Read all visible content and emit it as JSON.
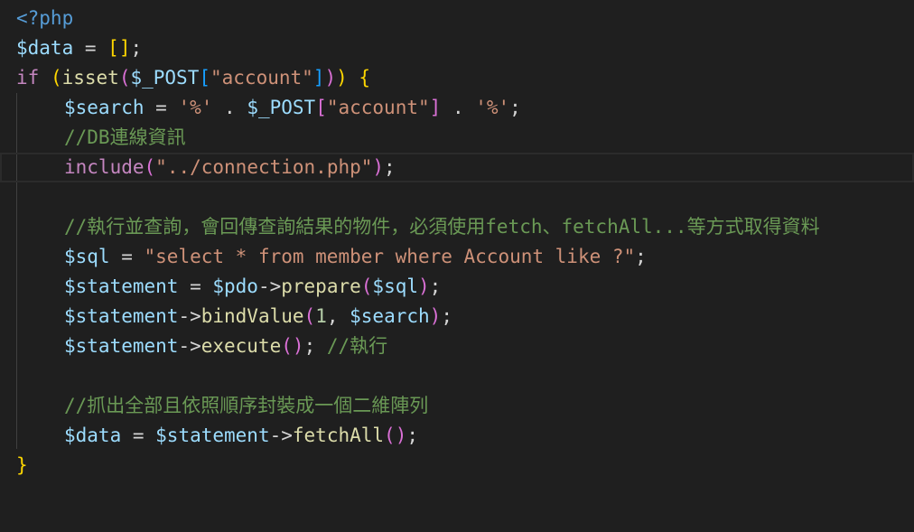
{
  "editor": {
    "language": "php",
    "lines": [
      [
        {
          "t": "<?php",
          "c": "kw-tag"
        }
      ],
      [
        {
          "t": "$data",
          "c": "var"
        },
        {
          "t": " = ",
          "c": "op"
        },
        {
          "t": "[",
          "c": "b1"
        },
        {
          "t": "]",
          "c": "b1"
        },
        {
          "t": ";",
          "c": "op"
        }
      ],
      [
        {
          "t": "if",
          "c": "kw"
        },
        {
          "t": " ",
          "c": "op"
        },
        {
          "t": "(",
          "c": "b1"
        },
        {
          "t": "isset",
          "c": "fn"
        },
        {
          "t": "(",
          "c": "b2"
        },
        {
          "t": "$_POST",
          "c": "var"
        },
        {
          "t": "[",
          "c": "b3"
        },
        {
          "t": "\"account\"",
          "c": "str"
        },
        {
          "t": "]",
          "c": "b3"
        },
        {
          "t": ")",
          "c": "b2"
        },
        {
          "t": ")",
          "c": "b1"
        },
        {
          "t": " ",
          "c": "op"
        },
        {
          "t": "{",
          "c": "b1"
        }
      ],
      [
        {
          "ind": 1
        },
        {
          "t": "$search",
          "c": "var"
        },
        {
          "t": " = ",
          "c": "op"
        },
        {
          "t": "'%'",
          "c": "str"
        },
        {
          "t": " . ",
          "c": "op"
        },
        {
          "t": "$_POST",
          "c": "var"
        },
        {
          "t": "[",
          "c": "b2"
        },
        {
          "t": "\"account\"",
          "c": "str"
        },
        {
          "t": "]",
          "c": "b2"
        },
        {
          "t": " . ",
          "c": "op"
        },
        {
          "t": "'%'",
          "c": "str"
        },
        {
          "t": ";",
          "c": "op"
        }
      ],
      [
        {
          "ind": 1
        },
        {
          "t": "//DB連線資訊",
          "c": "cmt"
        }
      ],
      [
        {
          "ind": 1
        },
        {
          "t": "include",
          "c": "kw"
        },
        {
          "t": "(",
          "c": "b2"
        },
        {
          "t": "\"../connection.php\"",
          "c": "str"
        },
        {
          "t": ")",
          "c": "b2"
        },
        {
          "t": ";",
          "c": "op"
        }
      ],
      [],
      [
        {
          "ind": 1
        },
        {
          "t": "//執行並查詢，會回傳查詢結果的物件，必須使用fetch、fetchAll...等方式取得資料",
          "c": "cmt"
        }
      ],
      [
        {
          "ind": 1
        },
        {
          "t": "$sql",
          "c": "var"
        },
        {
          "t": " = ",
          "c": "op"
        },
        {
          "t": "\"select * from member where Account like ?\"",
          "c": "str"
        },
        {
          "t": ";",
          "c": "op"
        }
      ],
      [
        {
          "ind": 1
        },
        {
          "t": "$statement",
          "c": "var"
        },
        {
          "t": " = ",
          "c": "op"
        },
        {
          "t": "$pdo",
          "c": "var"
        },
        {
          "t": "->",
          "c": "op"
        },
        {
          "t": "prepare",
          "c": "fn"
        },
        {
          "t": "(",
          "c": "b2"
        },
        {
          "t": "$sql",
          "c": "var"
        },
        {
          "t": ")",
          "c": "b2"
        },
        {
          "t": ";",
          "c": "op"
        }
      ],
      [
        {
          "ind": 1
        },
        {
          "t": "$statement",
          "c": "var"
        },
        {
          "t": "->",
          "c": "op"
        },
        {
          "t": "bindValue",
          "c": "fn"
        },
        {
          "t": "(",
          "c": "b2"
        },
        {
          "t": "1",
          "c": "num"
        },
        {
          "t": ", ",
          "c": "op"
        },
        {
          "t": "$search",
          "c": "var"
        },
        {
          "t": ")",
          "c": "b2"
        },
        {
          "t": ";",
          "c": "op"
        }
      ],
      [
        {
          "ind": 1
        },
        {
          "t": "$statement",
          "c": "var"
        },
        {
          "t": "->",
          "c": "op"
        },
        {
          "t": "execute",
          "c": "fn"
        },
        {
          "t": "(",
          "c": "b2"
        },
        {
          "t": ")",
          "c": "b2"
        },
        {
          "t": "; ",
          "c": "op"
        },
        {
          "t": "//執行",
          "c": "cmt"
        }
      ],
      [],
      [
        {
          "ind": 1
        },
        {
          "t": "//抓出全部且依照順序封裝成一個二維陣列",
          "c": "cmt"
        }
      ],
      [
        {
          "ind": 1
        },
        {
          "t": "$data",
          "c": "var"
        },
        {
          "t": " = ",
          "c": "op"
        },
        {
          "t": "$statement",
          "c": "var"
        },
        {
          "t": "->",
          "c": "op"
        },
        {
          "t": "fetchAll",
          "c": "fn"
        },
        {
          "t": "(",
          "c": "b2"
        },
        {
          "t": ")",
          "c": "b2"
        },
        {
          "t": ";",
          "c": "op"
        }
      ],
      [
        {
          "t": "}",
          "c": "b1"
        }
      ]
    ],
    "current_line": 5
  }
}
